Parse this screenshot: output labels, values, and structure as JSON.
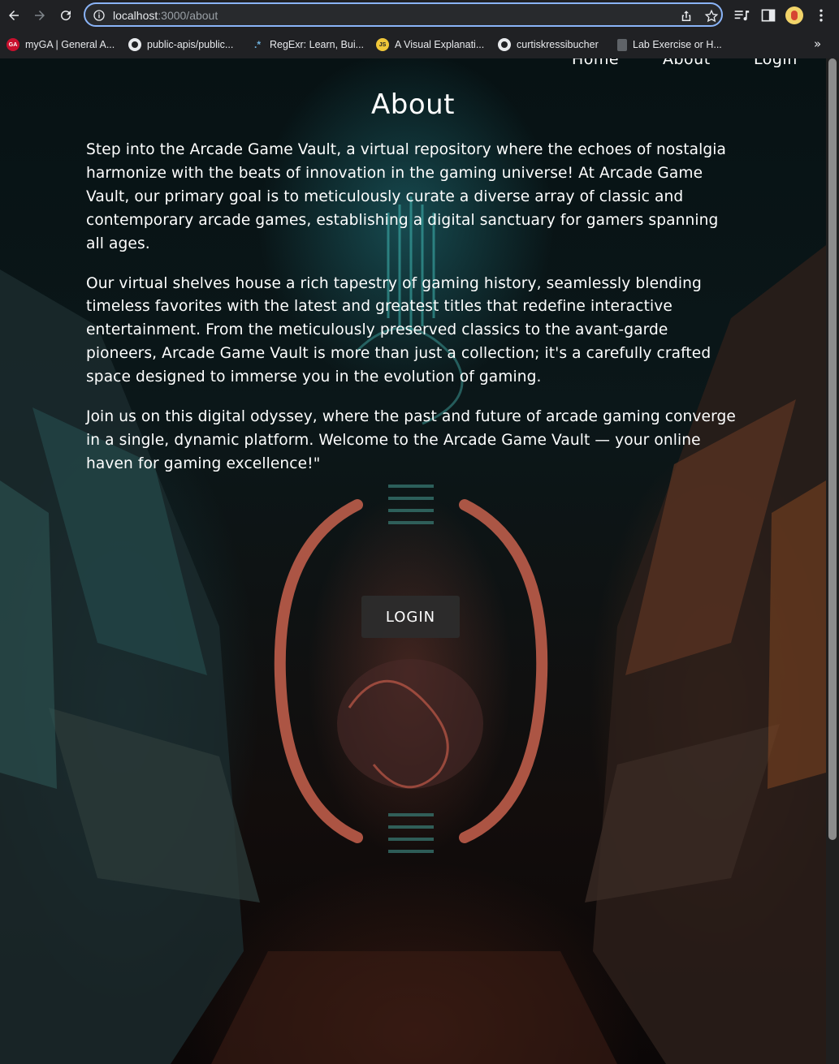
{
  "browser": {
    "url_host": "localhost",
    "url_path": ":3000/about",
    "bookmarks": [
      {
        "label": "myGA | General A...",
        "icon": "ga-icon"
      },
      {
        "label": "public-apis/public...",
        "icon": "github-icon"
      },
      {
        "label": "RegExr: Learn, Bui...",
        "icon": "regexr-icon"
      },
      {
        "label": "A Visual Explanati...",
        "icon": "js-icon"
      },
      {
        "label": "curtiskressibucher",
        "icon": "github-icon"
      },
      {
        "label": "Lab Exercise or H...",
        "icon": "doc-icon"
      }
    ],
    "more_bookmarks": "»"
  },
  "nav": {
    "home": "Home",
    "about": "About",
    "login": "Login"
  },
  "page": {
    "title": "About",
    "paragraphs": [
      "Step into the Arcade Game Vault, a virtual repository where the echoes of nostalgia harmonize with the beats of innovation in the gaming universe! At Arcade Game Vault, our primary goal is to meticulously curate a diverse array of classic and contemporary arcade games, establishing a digital sanctuary for gamers spanning all ages.",
      "Our virtual shelves house a rich tapestry of gaming history, seamlessly blending timeless favorites with the latest and greatest titles that redefine interactive entertainment. From the meticulously preserved classics to the avant-garde pioneers, Arcade Game Vault is more than just a collection; it's a carefully crafted space designed to immerse you in the evolution of gaming.",
      "Join us on this digital odyssey, where the past and future of arcade gaming converge in a single, dynamic platform. Welcome to the Arcade Game Vault — your online haven for gaming excellence!\""
    ],
    "login_button": "LOGIN"
  },
  "colors": {
    "chrome_bg": "#202124",
    "omnibox_border": "#8ab4f8",
    "text": "#ffffff",
    "button_bg": "#2d2d2d"
  }
}
